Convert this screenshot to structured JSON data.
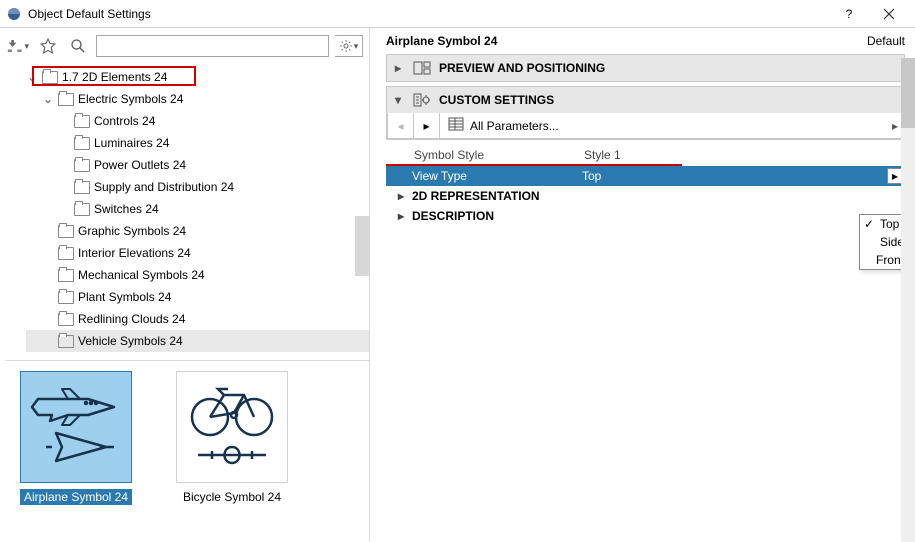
{
  "window": {
    "title": "Object Default Settings"
  },
  "toolbar": {
    "search_placeholder": ""
  },
  "tree": {
    "root": {
      "label": "1.7 2D Elements 24"
    },
    "electric": {
      "label": "Electric Symbols 24"
    },
    "children_electric": [
      {
        "label": "Controls 24"
      },
      {
        "label": "Luminaires 24"
      },
      {
        "label": "Power Outlets 24"
      },
      {
        "label": "Supply and Distribution 24"
      },
      {
        "label": "Switches 24"
      }
    ],
    "siblings": [
      {
        "label": "Graphic Symbols 24"
      },
      {
        "label": "Interior Elevations 24"
      },
      {
        "label": "Mechanical Symbols 24"
      },
      {
        "label": "Plant Symbols 24"
      },
      {
        "label": "Redlining Clouds 24"
      },
      {
        "label": "Vehicle Symbols 24"
      }
    ]
  },
  "thumbs": [
    {
      "label": "Airplane Symbol 24",
      "selected": true
    },
    {
      "label": "Bicycle Symbol 24",
      "selected": false
    }
  ],
  "right": {
    "object_name": "Airplane Symbol 24",
    "default_label": "Default",
    "panels": {
      "preview": "PREVIEW AND POSITIONING",
      "custom": "CUSTOM SETTINGS"
    },
    "paramnav": {
      "all": "All Parameters..."
    },
    "table": {
      "head": {
        "c1": "Symbol Style",
        "c2": "Style 1"
      },
      "view_type": {
        "label": "View Type",
        "value": "Top"
      },
      "groups": [
        {
          "label": "2D REPRESENTATION"
        },
        {
          "label": "DESCRIPTION"
        }
      ]
    },
    "popup": [
      {
        "label": "Top",
        "checked": true
      },
      {
        "label": "Side",
        "checked": false
      },
      {
        "label": "Front",
        "checked": false
      }
    ]
  }
}
